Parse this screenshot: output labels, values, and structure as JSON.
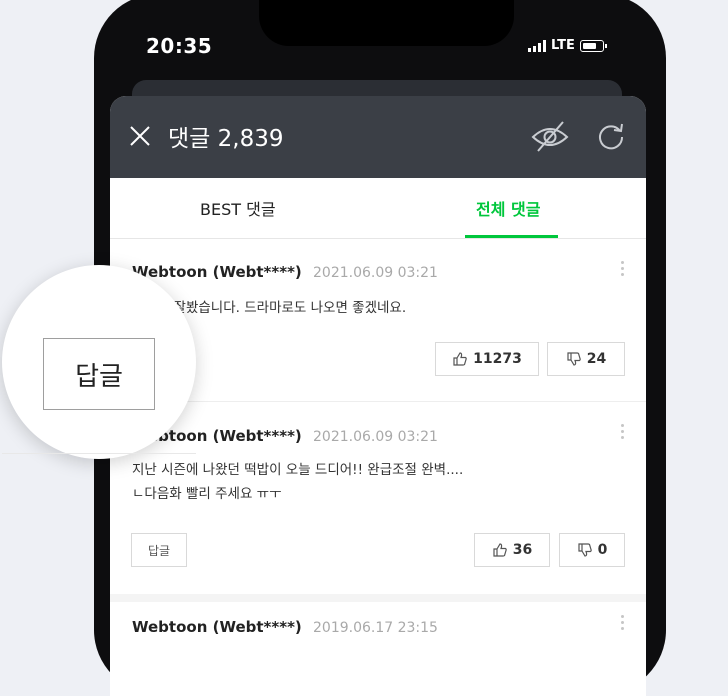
{
  "status_bar": {
    "time": "20:35",
    "network": "LTE"
  },
  "header": {
    "title": "댓글 2,839"
  },
  "tabs": [
    {
      "label": "BEST 댓글",
      "active": false
    },
    {
      "label": "전체 댓글",
      "active": true
    }
  ],
  "comments": [
    {
      "author": "Webtoon (Webt****)",
      "date": "2021.06.09 03:21",
      "lines": [
        "재밌게 잘봤습니다. 드라마로도 나오면 좋겠네요."
      ],
      "reply_label": "답글",
      "likes": "11273",
      "dislikes": "24"
    },
    {
      "author": "Webtoon (Webt****)",
      "date": "2021.06.09 03:21",
      "lines": [
        "지난 시즌에 나왔던 떡밥이 오늘 드디어!! 완급조절 완벽....",
        "ㄴ다음화 빨리 주세요 ㅠㅜ"
      ],
      "reply_label": "답글",
      "likes": "36",
      "dislikes": "0"
    },
    {
      "author": "Webtoon (Webt****)",
      "date": "2019.06.17 23:15"
    }
  ],
  "magnifier": {
    "label": "답글"
  },
  "colors": {
    "accent": "#00c73c",
    "header_bg": "#3b3f46"
  }
}
